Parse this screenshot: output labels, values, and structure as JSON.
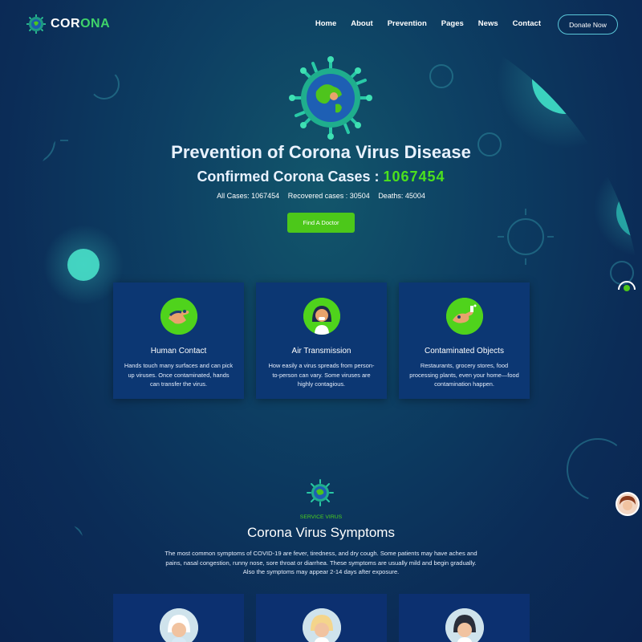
{
  "header": {
    "logo_part1": "COR",
    "logo_part2": "ONA",
    "nav": [
      "Home",
      "About",
      "Prevention",
      "Pages",
      "News",
      "Contact"
    ],
    "donate_label": "Donate Now"
  },
  "hero": {
    "title": "Prevention of Corona Virus Disease",
    "cases_label": "Confirmed Corona Cases : ",
    "cases_value": "1067454",
    "all_cases": "All Cases: 1067454",
    "recovered": "Recovered cases : 30504",
    "deaths": "Deaths: 45004",
    "button_label": "Find A Doctor"
  },
  "cards": [
    {
      "title": "Human Contact",
      "desc": "Hands touch many surfaces and can pick up viruses. Once contaminated, hands can transfer the virus."
    },
    {
      "title": "Air Transmission",
      "desc": "How easily a virus spreads from person-to-person can vary. Some viruses are highly contagious."
    },
    {
      "title": "Contaminated Objects",
      "desc": "Restaurants, grocery stores, food processing plants, even your home—food contamination happen."
    }
  ],
  "symptoms": {
    "subtitle": "SERVICE VIRUS",
    "title": "Corona Virus Symptoms",
    "desc": "The most common symptoms of COVID-19 are fever, tiredness, and dry cough. Some patients may have aches and pains, nasal congestion, runny nose, sore throat or diarrhea. These symptoms are usually mild and begin gradually. Also the symptoms may appear 2-14 days after exposure."
  },
  "colors": {
    "accent_green": "#4ce11d",
    "background": "#0d3f63",
    "card_bg": "#0c3773"
  }
}
